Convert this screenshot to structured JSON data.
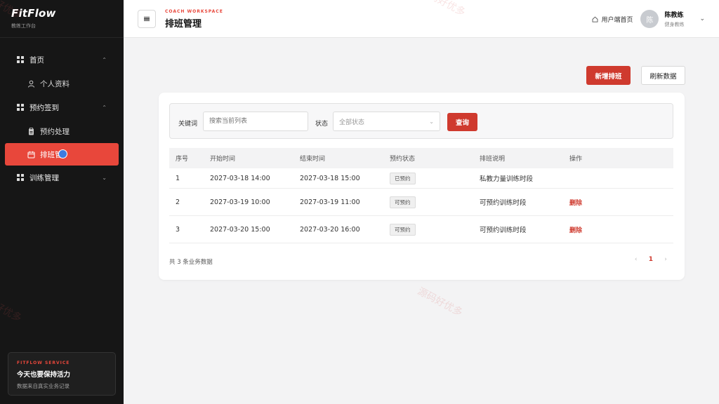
{
  "brand": {
    "logo": "FitFlow",
    "subtitle": "教练工作台"
  },
  "sidebar": {
    "groups": [
      {
        "label": "首页",
        "items": [
          {
            "label": "个人资料",
            "icon": "user-icon"
          }
        ]
      },
      {
        "label": "预约签到",
        "items": [
          {
            "label": "预约处理",
            "icon": "clipboard-icon"
          },
          {
            "label": "排班管",
            "icon": "calendar-icon",
            "active": true
          }
        ]
      },
      {
        "label": "训练管理",
        "items": []
      }
    ]
  },
  "promo": {
    "tag": "FITFLOW SERVICE",
    "title": "今天也要保持活力",
    "desc": "数据来自真实业务记录"
  },
  "header": {
    "kicker": "COACH WORKSPACE",
    "title": "排班管理",
    "home_link": "用户端首页",
    "avatar_text": "陈",
    "user_name": "陈教练",
    "user_role": "健身教练"
  },
  "toolbar": {
    "add_label": "新增排班",
    "refresh_label": "刷新数据"
  },
  "filter": {
    "keyword_label": "关键词",
    "keyword_placeholder": "搜索当前列表",
    "status_label": "状态",
    "status_value": "全部状态",
    "query_label": "查询"
  },
  "table": {
    "headers": [
      "序号",
      "开始时间",
      "结束时间",
      "预约状态",
      "排班说明",
      "操作"
    ],
    "rows": [
      {
        "no": "1",
        "start": "2027-03-18 14:00",
        "end": "2027-03-18 15:00",
        "status": "已预约",
        "note": "私教力量训练时段",
        "action": ""
      },
      {
        "no": "2",
        "start": "2027-03-19 10:00",
        "end": "2027-03-19 11:00",
        "status": "可预约",
        "note": "可预约训练时段",
        "action": "删除"
      },
      {
        "no": "3",
        "start": "2027-03-20 15:00",
        "end": "2027-03-20 16:00",
        "status": "可预约",
        "note": "可预约训练时段",
        "action": "删除"
      }
    ]
  },
  "footer": {
    "count_text": "共 3 条业务数据",
    "current_page": "1"
  },
  "watermark": "源码好优多",
  "colors": {
    "accent": "#cf3a2e",
    "sidebar_bg": "#161616",
    "active_nav": "#e8473b"
  }
}
